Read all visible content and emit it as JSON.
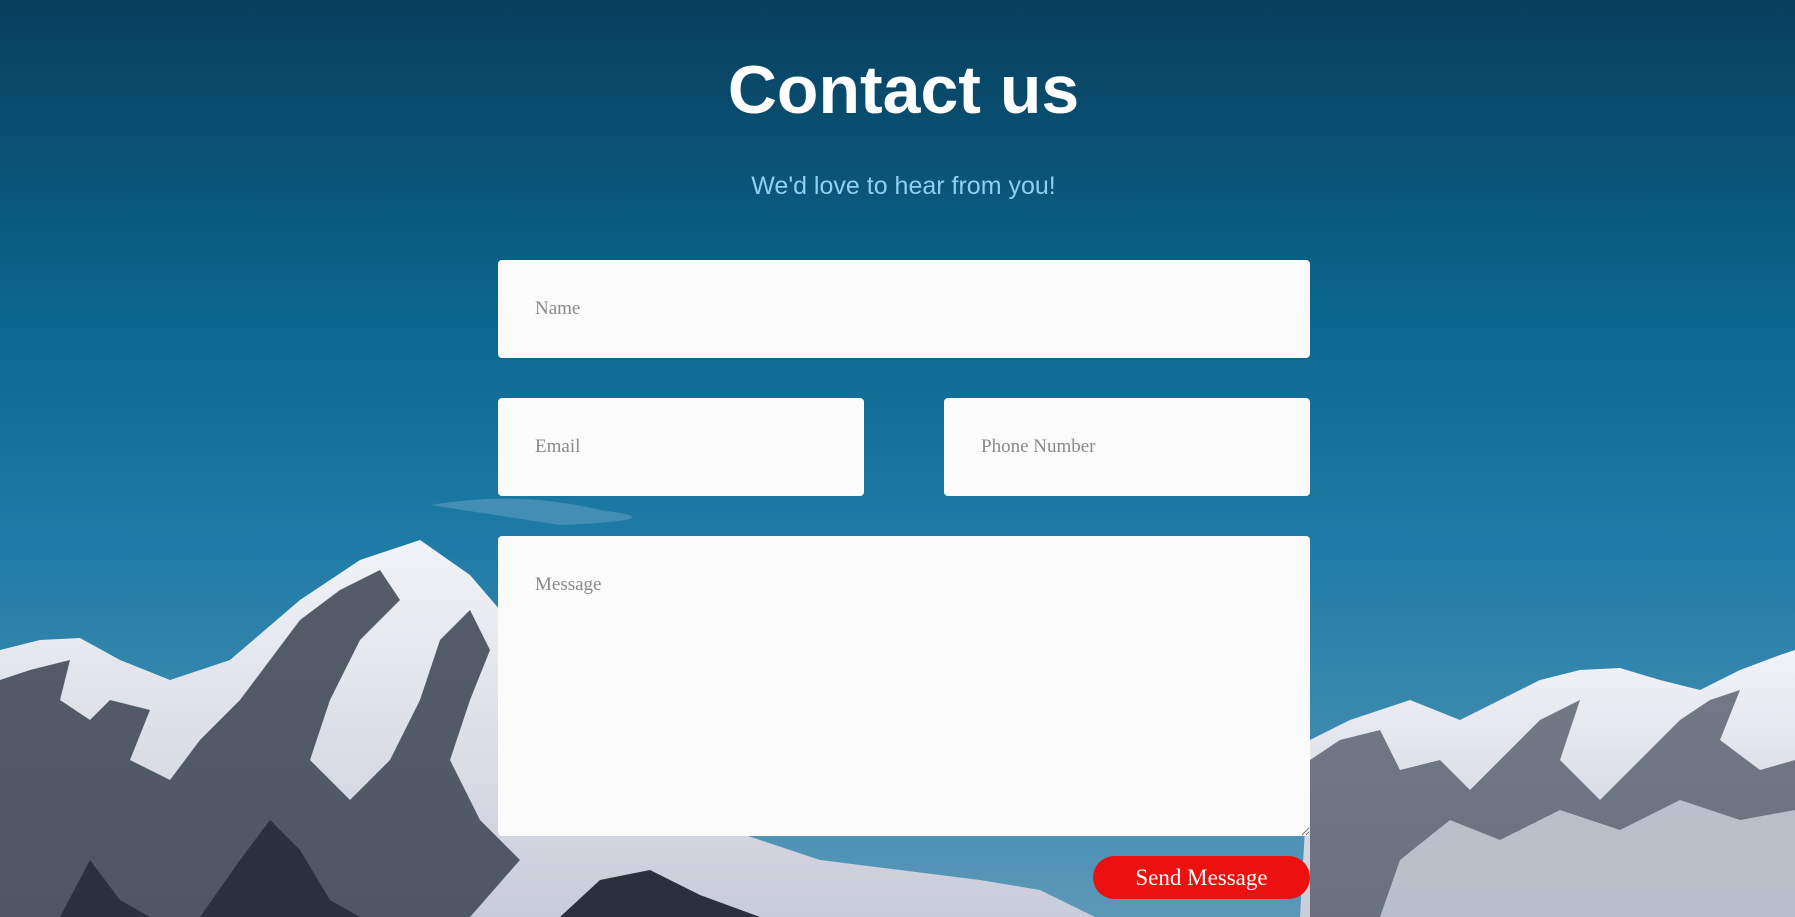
{
  "header": {
    "title": "Contact us",
    "subtitle": "We'd love to hear from you!"
  },
  "form": {
    "name_placeholder": "Name",
    "email_placeholder": "Email",
    "phone_placeholder": "Phone Number",
    "message_placeholder": "Message",
    "send_label": "Send Message"
  },
  "colors": {
    "sky_top": "#083e5c",
    "sky_bottom": "#3f88ad",
    "subtitle": "#8fd0f2",
    "field_background": "#fbfbfb",
    "button": "#ec1010"
  },
  "background": {
    "image": "snowy-mountains"
  }
}
